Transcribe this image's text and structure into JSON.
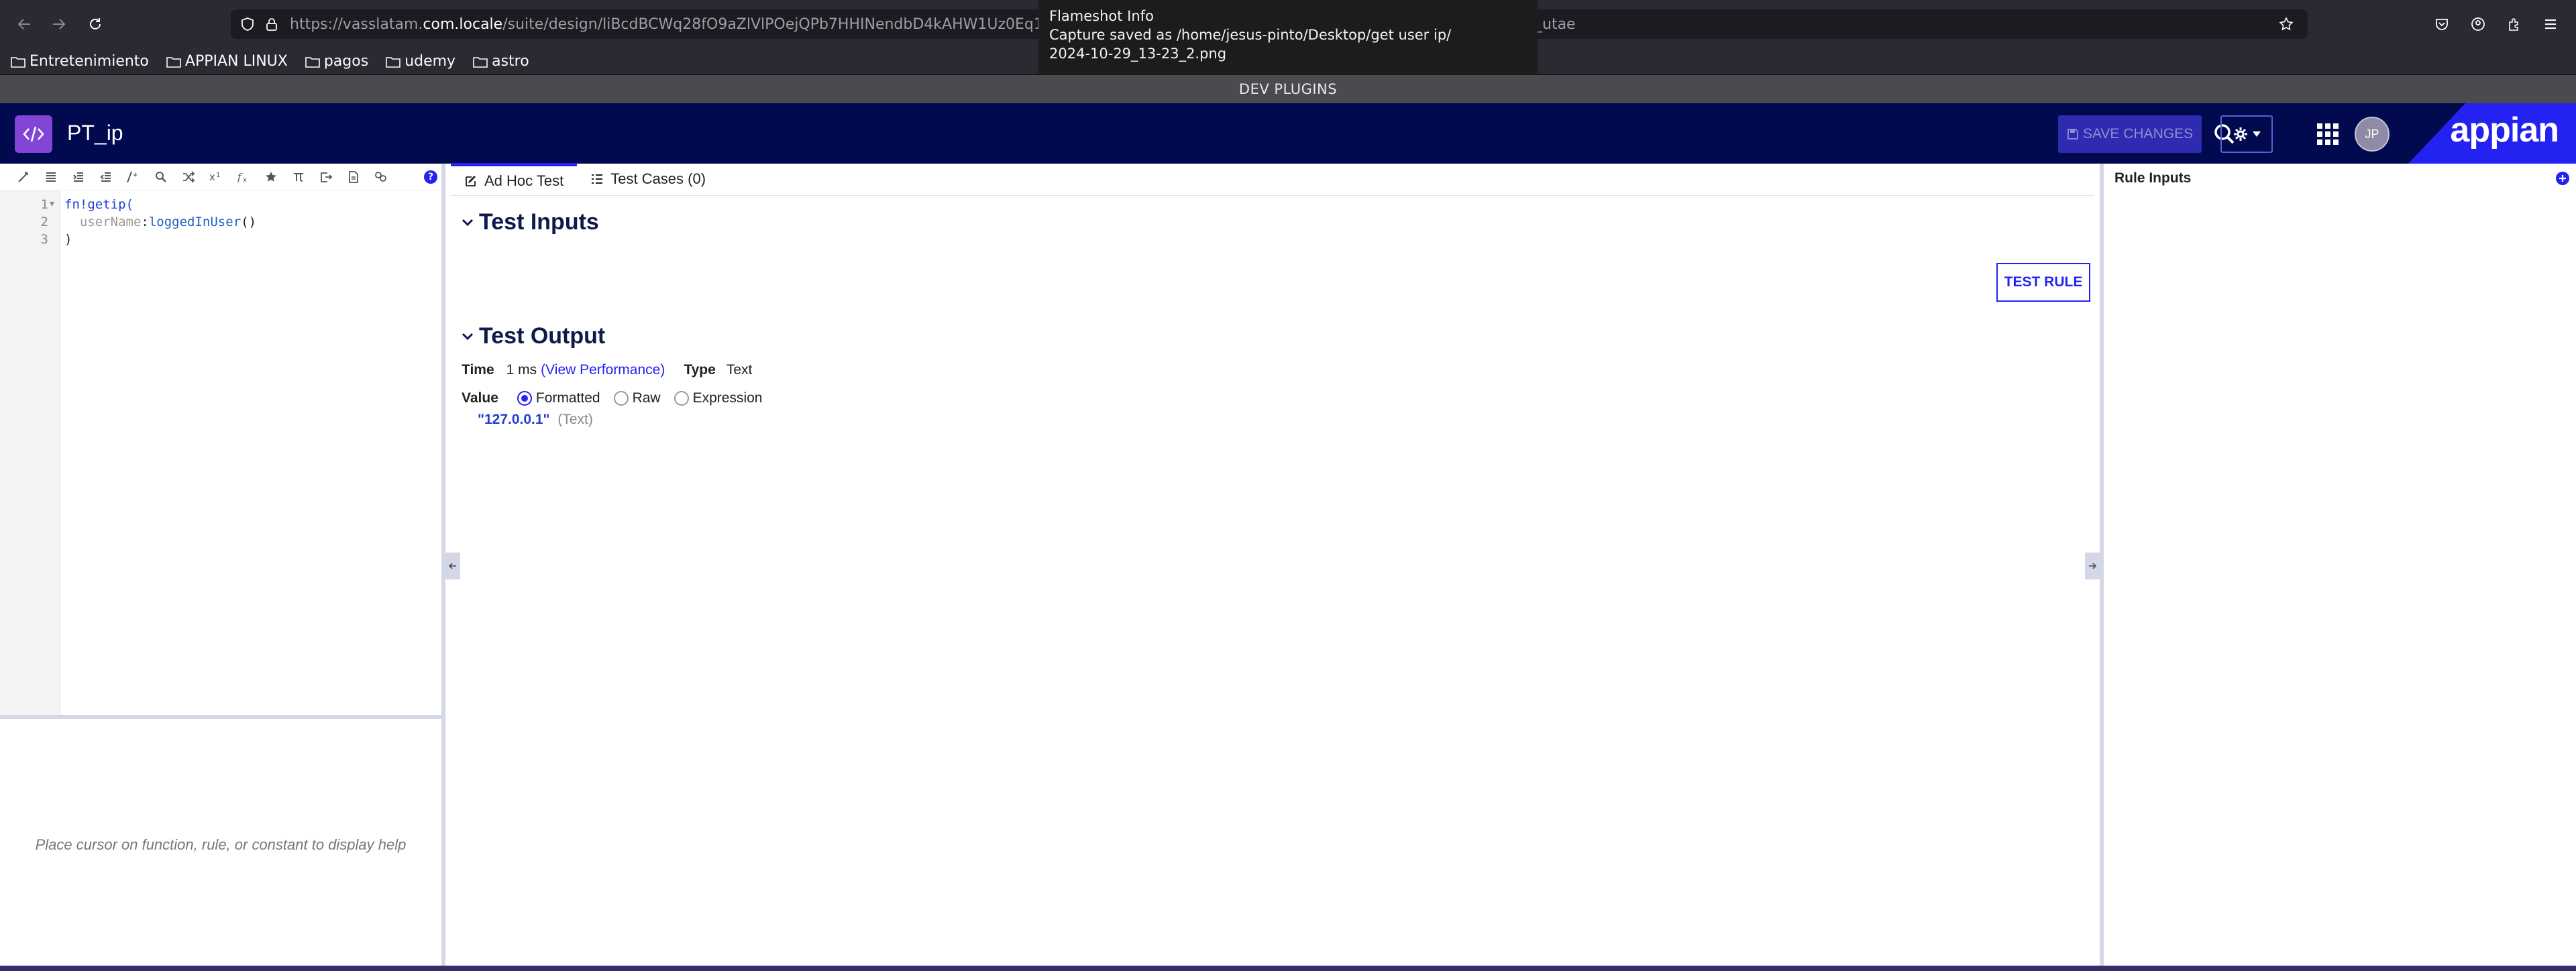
{
  "browser": {
    "url": "https://vasslatam.com.locale/suite/design/liBcdBCWq28fO9aZlVlPOejQPb7HHINendbD4kAHW1Uz0Eq1N6",
    "url_prefix": "https://vasslatam.",
    "url_host": "com.locale",
    "url_path": "/suite/design/liBcdBCWq28fO9aZlVlPOejQPb7HHINendbD4kAHW1Uz0Eq1N6",
    "url_tail": "_utae",
    "bookmarks": [
      "Entretenimiento",
      "APPIAN LINUX",
      "pagos",
      "udemy",
      "astro"
    ],
    "dev_bar": "DEV PLUGINS"
  },
  "toast": {
    "title": "Flameshot Info",
    "line1": "Capture saved as /home/jesus-pinto/Desktop/get user ip/",
    "line2": "2024-10-29_13-23_2.png"
  },
  "header": {
    "object_name": "PT_ip",
    "save_label": "SAVE CHANGES",
    "avatar_initials": "JP",
    "logo": "appian"
  },
  "editor": {
    "lines": [
      {
        "num": "1",
        "fn": "fn!getip("
      },
      {
        "num": "2",
        "param": "userName",
        "sep": ":",
        "rule": "loggedInUser",
        "end": "()"
      },
      {
        "num": "3",
        "text": ")"
      }
    ],
    "help_text": "Place cursor on function, rule, or constant to display help"
  },
  "tabs": [
    {
      "label": "Ad Hoc Test"
    },
    {
      "label": "Test Cases (0)"
    }
  ],
  "test_inputs": {
    "title": "Test Inputs",
    "test_rule_label": "TEST RULE"
  },
  "test_output": {
    "title": "Test Output",
    "time_label": "Time",
    "time_value": "1 ms",
    "view_perf": "(View Performance)",
    "type_label": "Type",
    "type_value": "Text",
    "value_label": "Value",
    "radio_formatted": "Formatted",
    "radio_raw": "Raw",
    "radio_expression": "Expression",
    "result_value": "\"127.0.0.1\"",
    "result_type": "(Text)"
  },
  "rule_inputs": {
    "title": "Rule Inputs"
  }
}
